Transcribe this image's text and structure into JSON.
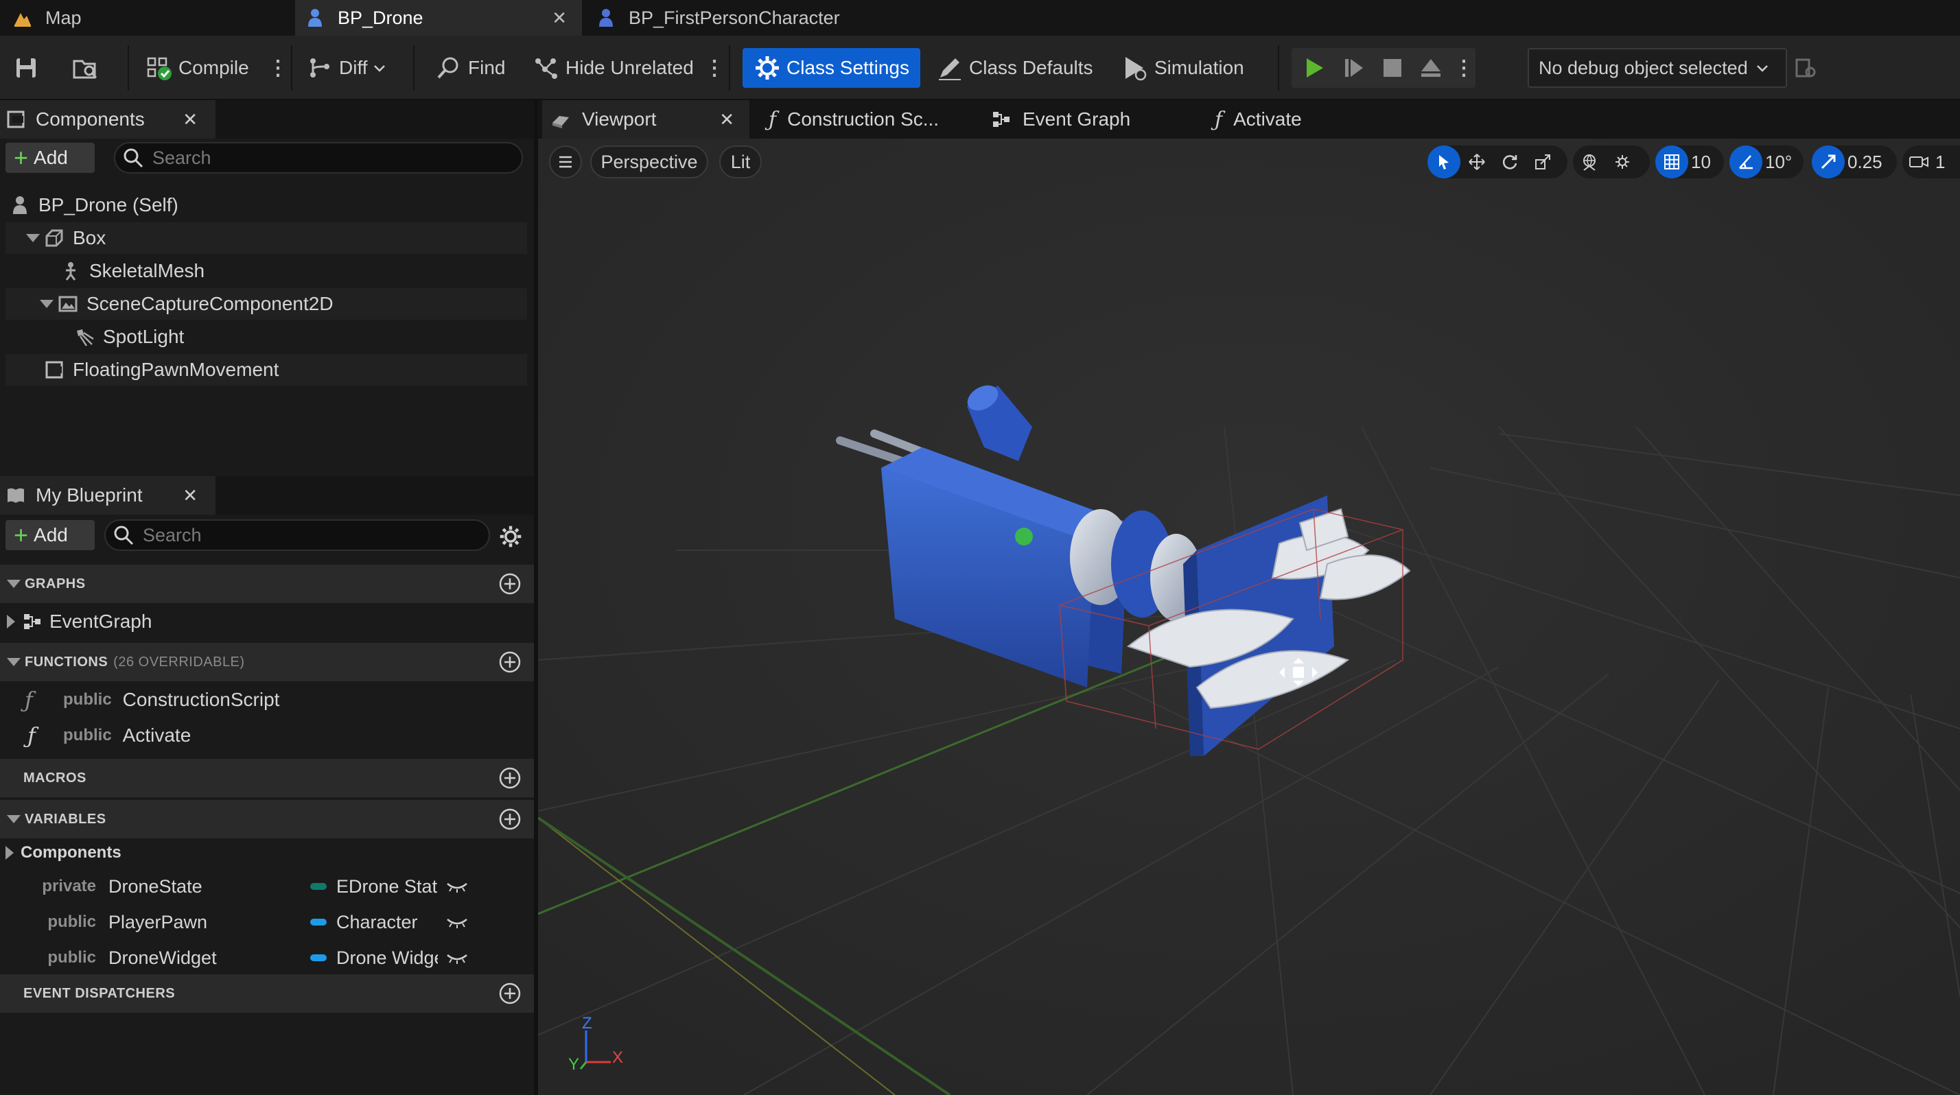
{
  "tabs": [
    {
      "label": "Map"
    },
    {
      "label": "BP_Drone"
    },
    {
      "label": "BP_FirstPersonCharacter"
    }
  ],
  "toolbar": {
    "compile": "Compile",
    "diff": "Diff",
    "find": "Find",
    "hide_unrelated": "Hide Unrelated",
    "class_settings": "Class Settings",
    "class_defaults": "Class Defaults",
    "simulation": "Simulation",
    "debug_object": "No debug object selected"
  },
  "components": {
    "title": "Components",
    "add": "Add",
    "search_placeholder": "Search",
    "items": [
      {
        "label": "BP_Drone (Self)"
      },
      {
        "label": "Box"
      },
      {
        "label": "SkeletalMesh"
      },
      {
        "label": "SceneCaptureComponent2D"
      },
      {
        "label": "SpotLight"
      },
      {
        "label": "FloatingPawnMovement"
      }
    ]
  },
  "my_blueprint": {
    "title": "My Blueprint",
    "add": "Add",
    "search_placeholder": "Search",
    "graphs": {
      "header": "GRAPHS",
      "items": [
        "EventGraph"
      ]
    },
    "functions": {
      "header": "FUNCTIONS",
      "sub": "(26 OVERRIDABLE)",
      "items": [
        {
          "access": "public",
          "name": "ConstructionScript"
        },
        {
          "access": "public",
          "name": "Activate"
        }
      ]
    },
    "macros": {
      "header": "MACROS"
    },
    "variables": {
      "header": "VARIABLES",
      "category": "Components",
      "items": [
        {
          "access": "private",
          "name": "DroneState",
          "type": "EDrone State",
          "color": "#0f7a6a"
        },
        {
          "access": "public",
          "name": "PlayerPawn",
          "type": "Character",
          "color": "#1e9be8"
        },
        {
          "access": "public",
          "name": "DroneWidget",
          "type": "Drone Widget",
          "color": "#1e9be8"
        }
      ]
    },
    "event_dispatchers": {
      "header": "EVENT DISPATCHERS"
    }
  },
  "editor_tabs": [
    {
      "label": "Viewport"
    },
    {
      "label": "Construction Sc..."
    },
    {
      "label": "Event Graph"
    },
    {
      "label": "Activate"
    }
  ],
  "viewport": {
    "perspective": "Perspective",
    "lit": "Lit",
    "grid_snap": "10",
    "rotation_snap": "10°",
    "scale_snap": "0.25",
    "camera_speed": "1",
    "axis": {
      "z": "Z",
      "y": "Y",
      "x": "X"
    }
  },
  "colors": {
    "accent": "#0d5fd0",
    "play": "#5cb72e",
    "drone_blue": "#2a4fb0"
  }
}
